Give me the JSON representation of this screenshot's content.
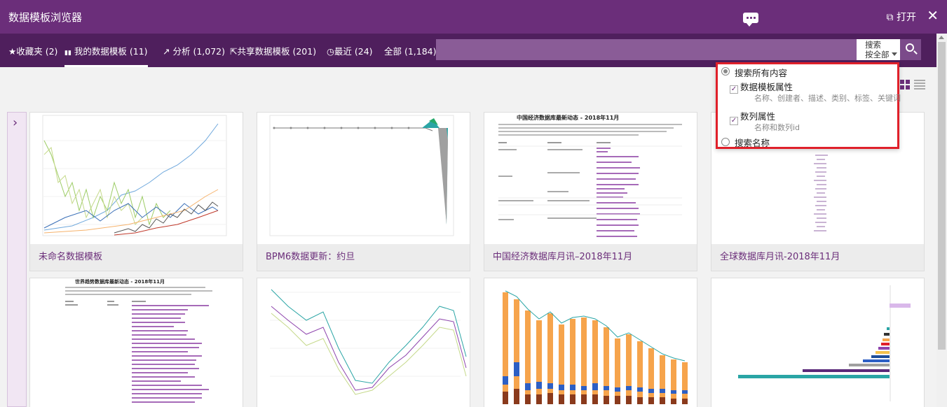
{
  "window": {
    "title": "数据模板浏览器",
    "open_label": "打开",
    "close_label": "✕"
  },
  "tabs": [
    {
      "icon": "★",
      "label": "收藏夹 (2)"
    },
    {
      "icon": "▮▮",
      "label": "我的数据模板 (11)"
    },
    {
      "icon": "↗",
      "label": "分析 (1,072)"
    },
    {
      "icon": "⇱",
      "label": "共享数据模板 (201)"
    },
    {
      "icon": "◷",
      "label": "最近 (24)"
    },
    {
      "icon": "",
      "label": "全部 (1,184)"
    }
  ],
  "search": {
    "value": "",
    "option_line1": "搜索",
    "option_line2": "按全部"
  },
  "dropdown": {
    "all_label": "搜索所有内容",
    "template_attr_label": "数据模板属性",
    "template_attr_desc": "名称、创建者、描述、类别、标签、关键词",
    "series_attr_label": "数列属性",
    "series_attr_desc": "名称和数列id",
    "name_label": "搜索名称"
  },
  "cards": [
    {
      "label": "未命名数据模板"
    },
    {
      "label": "BPM6数据更新：约旦"
    },
    {
      "label": "中国经济数据库月讯–2018年11月",
      "doc_title": "中国经济数据库最新动态 - 2018年11月"
    },
    {
      "label": "全球数据库月讯-2018年11月"
    },
    {
      "label": "",
      "doc_title": "世界趋势数据库最新动态 - 2018年11月"
    },
    {
      "label": ""
    },
    {
      "label": ""
    },
    {
      "label": ""
    }
  ],
  "colors": {
    "brand": "#6b2e7a",
    "nav": "#4f1f5d",
    "highlight": "#e0202a"
  }
}
